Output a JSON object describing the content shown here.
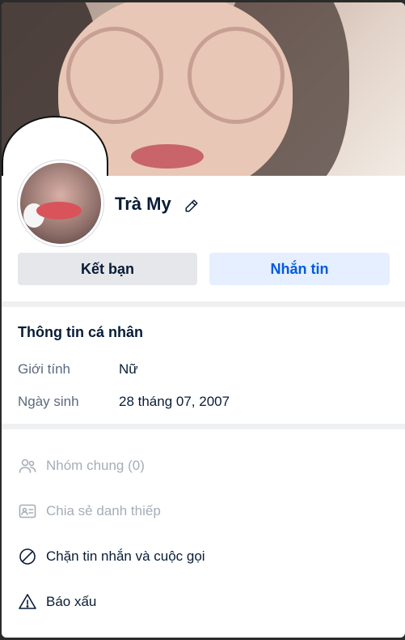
{
  "profile": {
    "name": "Trà My"
  },
  "buttons": {
    "add_friend": "Kết bạn",
    "message": "Nhắn tin"
  },
  "personal_info": {
    "title": "Thông tin cá nhân",
    "gender_label": "Giới tính",
    "gender_value": "Nữ",
    "birthday_label": "Ngày sinh",
    "birthday_value": "28 tháng 07, 2007"
  },
  "actions": [
    {
      "label": "Nhóm chung (0)",
      "icon": "users-group-icon",
      "enabled": false
    },
    {
      "label": "Chia sẻ danh thiếp",
      "icon": "contact-card-icon",
      "enabled": false
    },
    {
      "label": "Chặn tin nhắn và cuộc gọi",
      "icon": "block-icon",
      "enabled": true
    },
    {
      "label": "Báo xấu",
      "icon": "warning-icon",
      "enabled": true
    }
  ],
  "colors": {
    "primary": "#005ae0",
    "text": "#081c36",
    "muted": "#a6adb8"
  }
}
